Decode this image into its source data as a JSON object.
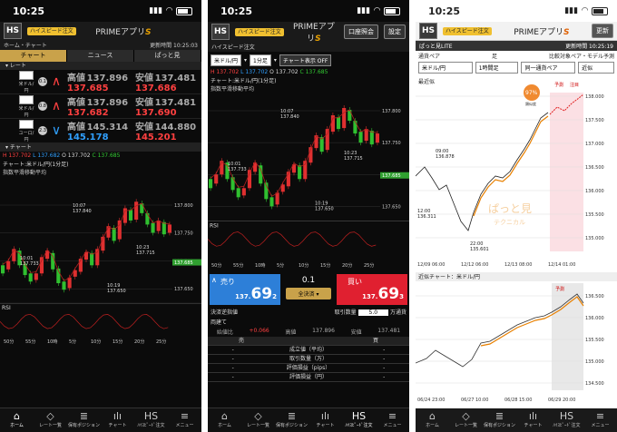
{
  "colors": {
    "up": "#ff4040",
    "down": "#30a0ff",
    "accent": "#c9a24a",
    "orange": "#e88000"
  },
  "screens": [
    {
      "time": "10:25",
      "appbar": {
        "hs": "HS",
        "badge": "ハイスピード注文",
        "title": "PRIMEアプリ",
        "title_s": "S",
        "right": ""
      },
      "crumb": {
        "left": "ホーム・チャート",
        "right": "更新時間 10:25:03"
      },
      "tabs": [
        "チャート",
        "ニュース",
        "ぱっと見"
      ],
      "rate_header": "レート",
      "rates": [
        {
          "pair": "米ドル/円",
          "n": "0.1",
          "dir": "up",
          "sell": "137.685",
          "buy": "137.686",
          "sell_lbl": "高値",
          "sell_sub": "137.896",
          "buy_lbl": "安値",
          "buy_sub": "137.481"
        },
        {
          "pair": "米ドル/円",
          "n": "0.8",
          "dir": "up",
          "sell": "137.682",
          "buy": "137.690",
          "sell_lbl": "高値",
          "sell_sub": "137.896",
          "buy_lbl": "安値",
          "buy_sub": "137.481"
        },
        {
          "pair": "ユーロ/円",
          "n": "2.3",
          "dir": "down",
          "sell": "145.178",
          "buy": "145.201",
          "sell_lbl": "高値",
          "sell_sub": "145.314",
          "buy_lbl": "安値",
          "buy_sub": "144.880"
        }
      ],
      "chart_header": "チャート",
      "ohlc": [
        "H 137.702",
        "L 137.682",
        "O 137.702",
        "C 137.685"
      ],
      "chart_title": "チャート:米ドル/円(1分足)",
      "chart_sub": "指数平滑移動平均",
      "yticks": [
        "137.800",
        "137.750",
        "137.700",
        "137.650"
      ],
      "ylast": "137.685",
      "ann": [
        {
          "t": "10:07",
          "v": "137.840"
        },
        {
          "t": "10:01",
          "v": "137.733"
        },
        {
          "t": "10:23",
          "v": "137.715"
        },
        {
          "t": "10:19",
          "v": "137.650"
        }
      ],
      "rsi": "RSI",
      "xticks": [
        "50分",
        "55分",
        "10時",
        "5分",
        "10分",
        "15分",
        "20分",
        "25分"
      ],
      "nav": [
        {
          "icon": "⌂",
          "label": "ホーム"
        },
        {
          "icon": "◇",
          "label": "レート一覧"
        },
        {
          "icon": "≣",
          "label": "保有ポジション"
        },
        {
          "icon": "ılı",
          "label": "チャート"
        },
        {
          "icon": "HS",
          "label": "ﾊｲｽﾋﾟｰﾄﾞ注文"
        },
        {
          "icon": "≡",
          "label": "メニュー"
        }
      ],
      "nav_active": 0
    },
    {
      "time": "10:25",
      "appbar": {
        "hs": "HS",
        "badge": "ハイスピード注文",
        "title": "PRIMEアプリ",
        "title_s": "S",
        "btn1": "口座照会",
        "btn2": "設定"
      },
      "controls": {
        "pair": "米ドル/円",
        "period": "1分足",
        "toggle": "チャート表示 OFF"
      },
      "ohlc": [
        "H 137.702",
        "L 137.702",
        "O 137.702",
        "C 137.685"
      ],
      "chart_title": "チャート:米ドル/円(1分足)",
      "chart_sub": "指数平滑移動平均",
      "yticks": [
        "137.800",
        "137.750",
        "137.700",
        "137.650"
      ],
      "ylast": "137.685",
      "ann": [
        {
          "t": "10:07",
          "v": "137.840"
        },
        {
          "t": "10:01",
          "v": "137.733"
        },
        {
          "t": "10:23",
          "v": "137.715"
        },
        {
          "t": "10:19",
          "v": "137.650"
        }
      ],
      "rsi": "RSI",
      "xticks": [
        "50分",
        "55分",
        "10時",
        "5分",
        "10分",
        "15分",
        "20分",
        "25分"
      ],
      "trade": {
        "sell_lbl": "売り",
        "buy_lbl": "買い",
        "spread": "0.1",
        "sell_price": "137.692",
        "buy_price": "137.693",
        "sell_big": "69",
        "sell_small": "2",
        "buy_big": "69",
        "buy_small": "3",
        "sell_pre": "137.",
        "buy_pre": "137.",
        "all_btn": "全決済 ▾",
        "qty_lbl": "取引数量",
        "qty": "5.0",
        "qty_unit": "万通貨"
      },
      "info": {
        "row1": "決済逆指値",
        "row2": "両建て",
        "h1": "始値比",
        "h1v": "+0.066",
        "h2": "高値",
        "h2v": "137.896",
        "h3": "安値",
        "h3v": "137.481"
      },
      "table": {
        "head_sell": "売",
        "head_buy": "買",
        "rows": [
          "成立値（平均）",
          "取引数量（万）",
          "評価損益（pips）",
          "評価損益（円）"
        ]
      },
      "nav": [
        {
          "icon": "⌂",
          "label": "ホーム"
        },
        {
          "icon": "◇",
          "label": "レート一覧"
        },
        {
          "icon": "≣",
          "label": "保有ポジション"
        },
        {
          "icon": "ılı",
          "label": "チャート"
        },
        {
          "icon": "HS",
          "label": "ﾊｲｽﾋﾟｰﾄﾞ注文"
        },
        {
          "icon": "≡",
          "label": "メニュー"
        }
      ],
      "nav_active": 4
    },
    {
      "time": "10:25",
      "appbar": {
        "hs": "HS",
        "badge": "ハイスピード注文",
        "title": "PRIMEアプリ",
        "title_s": "S",
        "btn": "更新"
      },
      "crumb": {
        "left": "ぱっと見LITE",
        "right": "更新時間 10:25:19"
      },
      "filters": {
        "l1": "通貨ペア",
        "l2": "足",
        "l3": "比較対象ペア・モデル予測",
        "pair": "米ドル/円",
        "period": "1時間足",
        "model": "同一通貨ペア",
        "near": "近似"
      },
      "panel1": {
        "title": "最近似",
        "pct": "97%",
        "pct_lbl": "類似度",
        "tag1": "予測",
        "tag2": "注目",
        "yticks": [
          "138.000",
          "137.500",
          "137.000",
          "136.500",
          "136.000",
          "135.500",
          "135.000"
        ],
        "ann": [
          {
            "t": "09:00",
            "v": "136.878"
          },
          {
            "t": "12:00",
            "v": "136.311"
          },
          {
            "t": "22:00",
            "v": "135.601"
          }
        ],
        "xticks": [
          "12/09 06:00",
          "12/12 06:00",
          "12/13 08:00",
          "12/14 01:00"
        ],
        "wm1": "ぱっと見",
        "wm2": "テクニカル"
      },
      "panel2": {
        "title": "近似チャート：米ドル/円",
        "tag": "予測",
        "yticks": [
          "136.500",
          "136.000",
          "135.500",
          "135.000",
          "134.500"
        ],
        "xticks": [
          "06/24 23:00",
          "06/27 10:00",
          "06/28 15:00",
          "06/29 20:00"
        ]
      },
      "nav": [
        {
          "icon": "⌂",
          "label": "ホーム"
        },
        {
          "icon": "◇",
          "label": "レート一覧"
        },
        {
          "icon": "≣",
          "label": "保有ポジション"
        },
        {
          "icon": "ılı",
          "label": "チャート"
        },
        {
          "icon": "HS",
          "label": "ﾊｲｽﾋﾟｰﾄﾞ注文"
        },
        {
          "icon": "≡",
          "label": "メニュー"
        }
      ],
      "nav_active": -1
    }
  ]
}
